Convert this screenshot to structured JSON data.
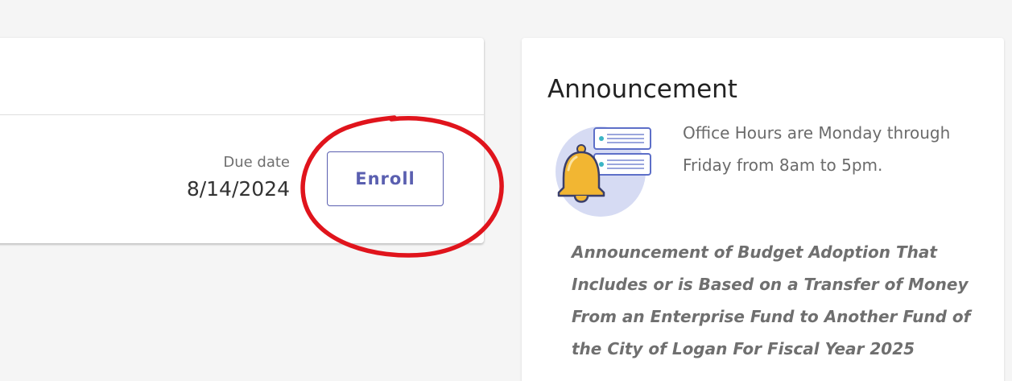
{
  "course": {
    "due_label": "Due date",
    "due_value": "8/14/2024",
    "enroll_label": "Enroll"
  },
  "announcement": {
    "title": "Announcement",
    "office_hours": "Office Hours are Monday through Friday from 8am to 5pm.",
    "budget_text": "Announcement of Budget Adoption That Includes or is Based on a Transfer of Money From an Enterprise Fund to Another Fund of the City of Logan For Fiscal Year 2025"
  },
  "colors": {
    "accent": "#5a5fb0",
    "annotation": "#e0141c",
    "bell": "#f2b632",
    "illustration_bg": "#d6dbf3"
  },
  "icons": {
    "bell": "bell-icon"
  }
}
